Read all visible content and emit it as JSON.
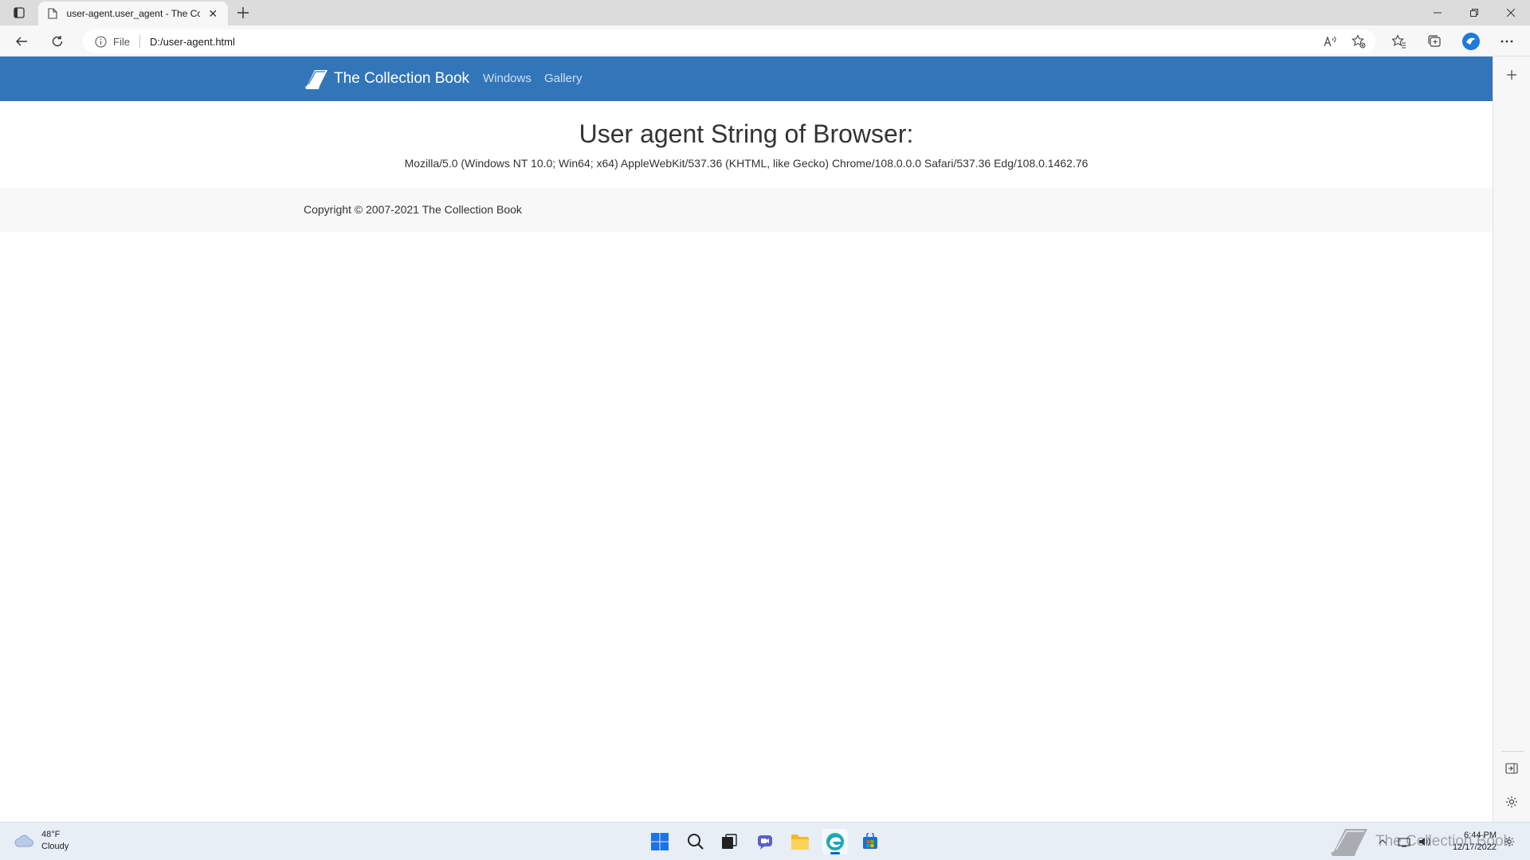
{
  "browser": {
    "tab_title": "user-agent.user_agent - The Coll",
    "address_scheme": "File",
    "address_url": "D:/user-agent.html"
  },
  "site": {
    "brand_name": "The Collection Book",
    "nav": [
      "Windows",
      "Gallery"
    ],
    "heading": "User agent String of Browser:",
    "user_agent": "Mozilla/5.0 (Windows NT 10.0; Win64; x64) AppleWebKit/537.36 (KHTML, like Gecko) Chrome/108.0.0.0 Safari/537.36 Edg/108.0.1462.76",
    "copyright": "Copyright © 2007-2021 The Collection Book",
    "navbar_color": "#3276b9"
  },
  "taskbar": {
    "weather_temp": "48°F",
    "weather_desc": "Cloudy",
    "clock_time": "6:44 PM",
    "clock_date": "12/17/2022",
    "watermark_text": "The Collection Book",
    "apps": [
      "start-icon",
      "search-icon",
      "task-view-icon",
      "chat-icon",
      "file-explorer-icon",
      "edge-icon",
      "store-icon"
    ]
  }
}
